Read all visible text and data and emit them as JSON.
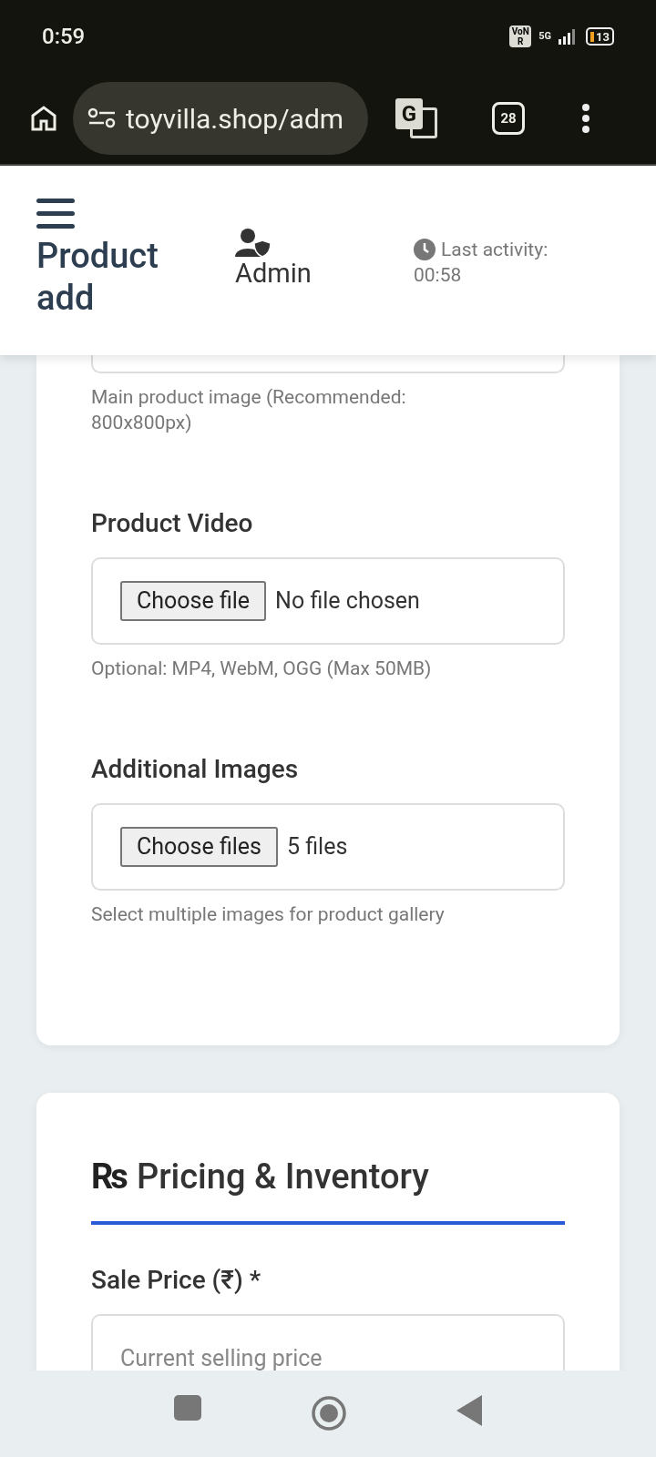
{
  "status_bar": {
    "time": "0:59",
    "voice_badge": "VoNR",
    "network": "5G",
    "battery": "13"
  },
  "browser": {
    "url": "toyvilla.shop/adm",
    "translate_glyph": "G",
    "tab_count": "28"
  },
  "header": {
    "title": "Product add",
    "user": "Admin",
    "activity_label": "Last activity:",
    "activity_time": "00:58"
  },
  "media_card": {
    "image_hint": "Main product image (Recommended: 800x800px)",
    "fields": [
      {
        "label": "Product Video",
        "button": "Choose file",
        "status": "No file chosen",
        "hint": "Optional: MP4, WebM, OGG (Max 50MB)"
      },
      {
        "label": "Additional Images",
        "button": "Choose files",
        "status": "5 files",
        "hint": "Select multiple images for product gallery"
      }
    ]
  },
  "pricing_card": {
    "icon_text": "Rs",
    "title": "Pricing & Inventory",
    "fields": [
      {
        "label": "Sale Price (₹) *",
        "placeholder": "Current selling price"
      }
    ]
  }
}
